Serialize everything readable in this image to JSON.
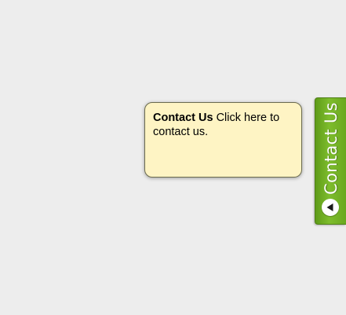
{
  "tooltip": {
    "title": "Contact Us",
    "body": " Click here to contact us."
  },
  "contact_tab": {
    "label": "Contact Us",
    "icon": "triangle-left-icon"
  },
  "colors": {
    "background": "#ededed",
    "tooltip_bg": "#fef4c4",
    "tab_green": "#7ebd2d"
  }
}
